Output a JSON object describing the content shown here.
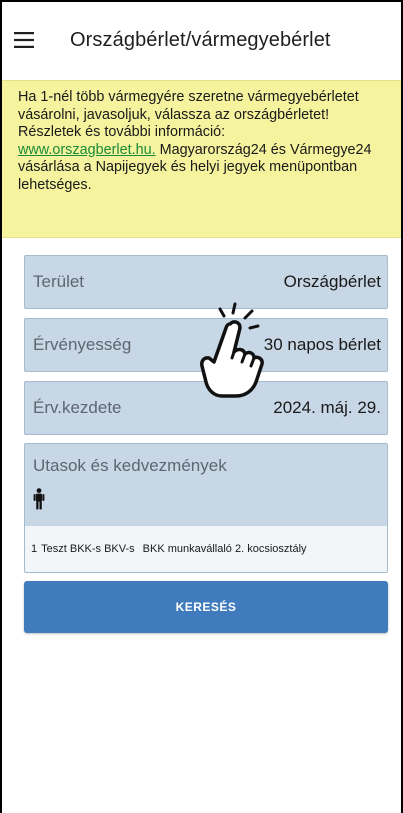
{
  "header": {
    "title": "Országbérlet/vármegyebérlet",
    "menu_icon": "hamburger-menu-icon"
  },
  "notice": {
    "line1": "Ha 1-nél több vármegyére szeretne vármegyebérletet vásárolni, javasoljuk, válassza az országbérletet!",
    "line2": "Részletek és további információ:",
    "link": "www.orszagberlet.hu.",
    "line3": " Magyarország24 és Vármegye24 vásárlása a Napijegyek és helyi jegyek menüpontban lehetséges.",
    "background": "#f5f39d",
    "link_color": "#1a8a3a"
  },
  "form": {
    "terulet": {
      "label": "Terület",
      "value": "Országbérlet"
    },
    "ervenyesseg": {
      "label": "Érvényesség",
      "value": "30 napos bérlet"
    },
    "erv_kezdete": {
      "label": "Érv.kezdete",
      "value": "2024. máj. 29."
    },
    "passengers": {
      "label": "Utasok és kedvezmények",
      "person_icon": "person-icon",
      "count": "1",
      "name": "Teszt BKK-s BKV-s",
      "discount": "BKK munkavállaló 2. kocsiosztály"
    },
    "field_color": "#c7d7e5"
  },
  "search": {
    "label": "KERESÉS",
    "color": "#3f7bbd"
  },
  "overlay": {
    "icon": "tap-hand-icon"
  }
}
